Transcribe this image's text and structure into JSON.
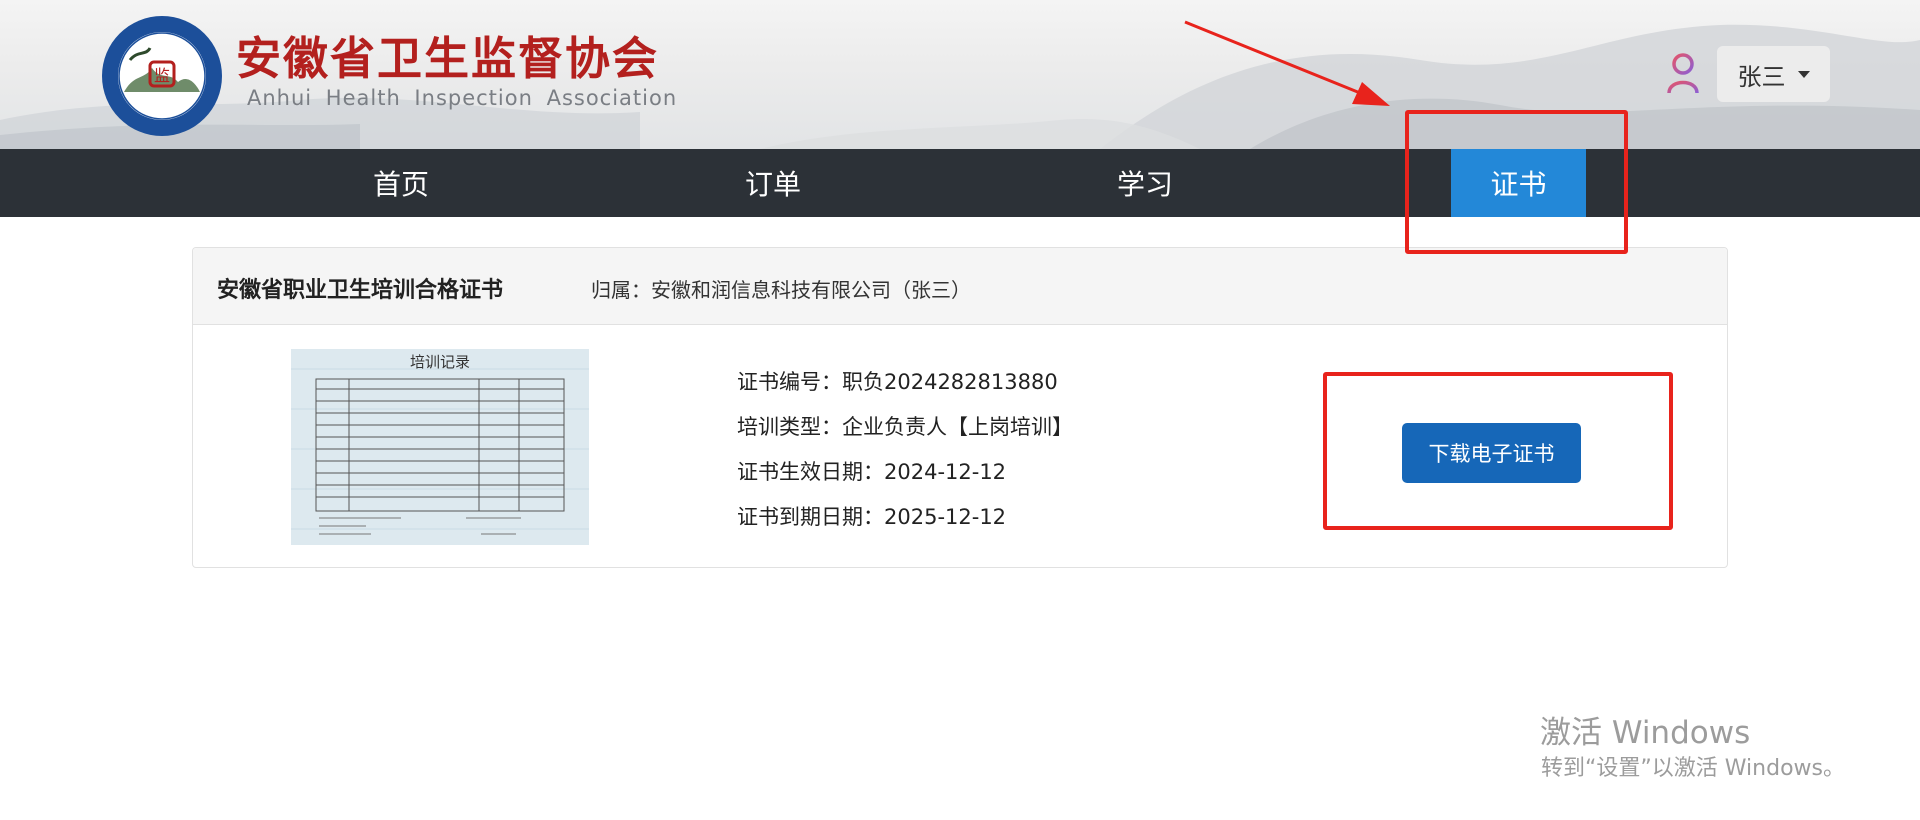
{
  "header": {
    "brand_cn": "安徽省卫生监督协会",
    "brand_en": "Anhui Health Inspection Association",
    "brand_color": "#b3201e",
    "user_name": "张三"
  },
  "nav": {
    "items": [
      {
        "label": "首页",
        "active": false
      },
      {
        "label": "订单",
        "active": false
      },
      {
        "label": "学习",
        "active": false
      },
      {
        "label": "证书",
        "active": true
      }
    ],
    "active_color": "#2388d8"
  },
  "certificate": {
    "title": "安徽省职业卫生培训合格证书",
    "owner": "归属：安徽和润信息科技有限公司（张三）",
    "thumbnail": {
      "title": "培训记录",
      "icon": "certificate-thumbnail"
    },
    "fields": [
      {
        "label": "证书编号：",
        "value": "职负2024282813880"
      },
      {
        "label": "培训类型：",
        "value": "企业负责人【上岗培训】"
      },
      {
        "label": "证书生效日期：",
        "value": "2024-12-12"
      },
      {
        "label": "证书到期日期：",
        "value": "2025-12-12"
      }
    ],
    "download_label": "下载电子证书"
  },
  "watermark": {
    "line1": "激活 Windows",
    "line2": "转到“设置”以激活 Windows。"
  },
  "annotation_color": "#e8231c"
}
